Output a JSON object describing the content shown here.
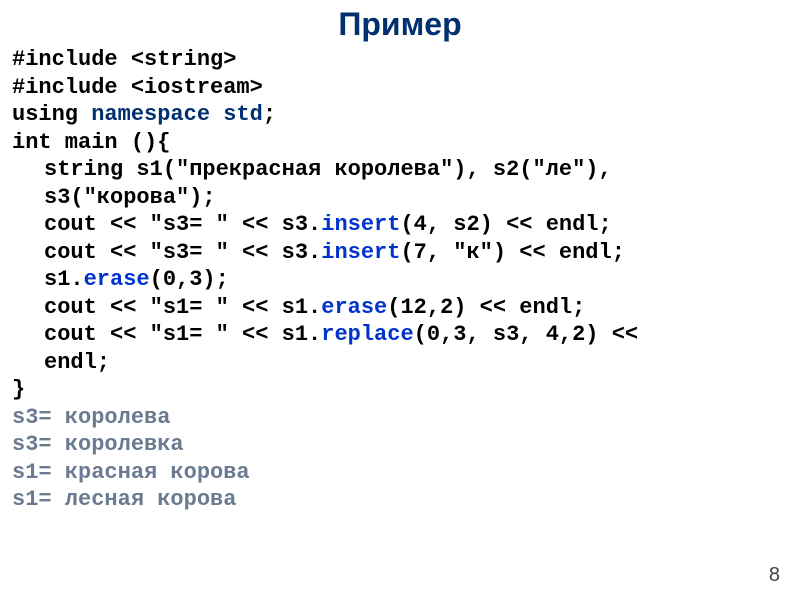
{
  "title": "Пример",
  "code": {
    "l1": "#include <string>",
    "l2": "#include <iostream>",
    "l3a": "using ",
    "l3b": "namespace",
    "l3c": " std",
    "l3d": ";",
    "l4": "int main (){",
    "l5a": "string s1(\"прекрасная королева\"), s2(\"ле\"),",
    "l5b": "s3(\"корова\");",
    "l6a": "cout << \"s3= \" << s3.",
    "l6b": "insert",
    "l6c": "(4, s2) << endl;",
    "l7a": "cout << \"s3= \" << s3.",
    "l7b": "insert",
    "l7c": "(7, \"к\") << endl;",
    "l8a": "s1.",
    "l8b": "erase",
    "l8c": "(0,3);",
    "l9a": "cout << \"s1= \" << s1.",
    "l9b": "erase",
    "l9c": "(12,2) << endl;",
    "l10a": "cout << \"s1= \" << s1.",
    "l10b": "replace",
    "l10c": "(0,3, s3, 4,2) <<",
    "l10d": "endl;",
    "l11": "}"
  },
  "output": {
    "o1": "s3= королева",
    "o2": "s3= королевка",
    "o3": "s1= красная корова",
    "o4": "s1= лесная корова"
  },
  "pagenum": "8"
}
